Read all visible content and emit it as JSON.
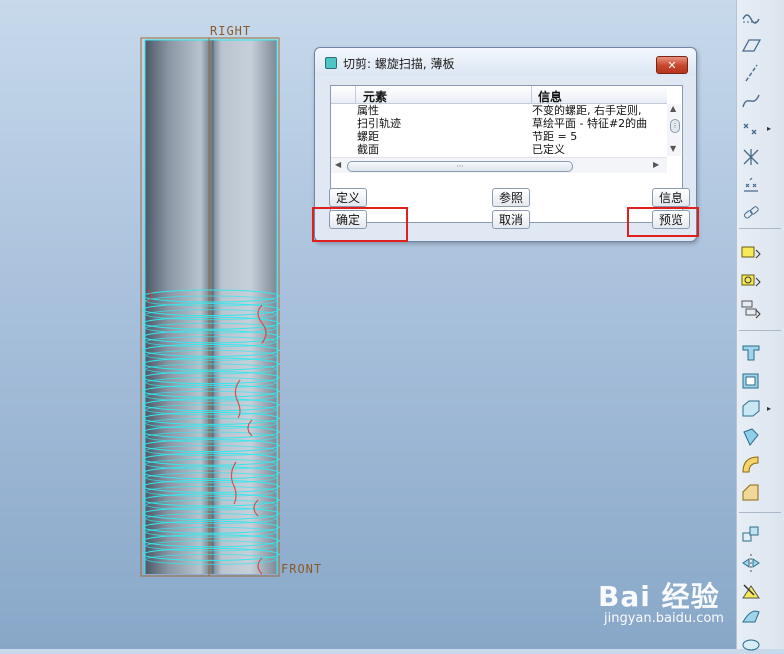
{
  "viewport": {
    "datum_labels": {
      "right_plane": "RIGHT",
      "front_plane": "FRONT"
    }
  },
  "dialog": {
    "title": "切剪: 螺旋扫描, 薄板",
    "close_icon": "close-icon",
    "table": {
      "columns": [
        "元素",
        "信息"
      ],
      "rows": [
        {
          "element": "属性",
          "info": "不变的螺距, 右手定则,"
        },
        {
          "element": "扫引轨迹",
          "info": "草绘平面 - 特征#2的曲"
        },
        {
          "element": "螺距",
          "info": "节距 = 5"
        },
        {
          "element": "截面",
          "info": "已定义"
        }
      ]
    },
    "buttons": {
      "define": "定义",
      "refs": "参照",
      "info": "信息",
      "ok": "确定",
      "cancel": "取消",
      "preview": "预览"
    }
  },
  "toolbar_icons": [
    "curve-tool-icon",
    "plane-icon",
    "axis-icon",
    "sketch-curve-icon",
    "point-icon",
    "cross-point-icon",
    "datum-pattern-icon",
    "chain-icon",
    "annotation-icon",
    "annotation-feature-icon",
    "annotation-element-icon",
    "extrude-icon",
    "shell-icon",
    "draft-icon",
    "revolve-icon",
    "round-icon",
    "chamfer-icon",
    "pattern-icon",
    "mirror-icon",
    "sweep-icon",
    "blend-icon",
    "extra-icon"
  ],
  "watermark": {
    "brand": "Bai 经验",
    "url": "jingyan.baidu.com"
  },
  "colors": {
    "helix": "#33e8ec",
    "section": "#d04040",
    "highlight": "#e0201f",
    "datum": "#8b5a2b"
  }
}
